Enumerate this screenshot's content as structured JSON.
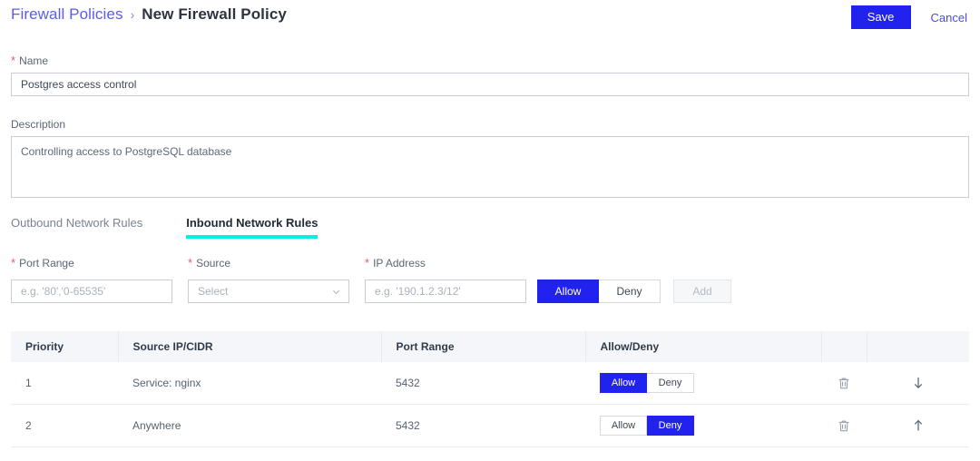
{
  "header": {
    "breadcrumb_root": "Firewall Policies",
    "breadcrumb_separator": "›",
    "breadcrumb_current": "New Firewall Policy",
    "save_label": "Save",
    "cancel_label": "Cancel",
    "accent_blue": "#2222ee",
    "link_blue": "#5b5bf0"
  },
  "form": {
    "name": {
      "label": "Name",
      "required": true,
      "value": "Postgres access control"
    },
    "description": {
      "label": "Description",
      "required": false,
      "value": "Controlling access to PostgreSQL database"
    }
  },
  "tabs": {
    "items": [
      {
        "label": "Outbound Network Rules",
        "active": false
      },
      {
        "label": "Inbound Network Rules",
        "active": true
      }
    ],
    "active_underline_color": "#06f0e0"
  },
  "rule_builder": {
    "port_range": {
      "label": "Port Range",
      "required": true,
      "placeholder": "e.g. '80','0-65535'",
      "value": ""
    },
    "source": {
      "label": "Source",
      "required": true,
      "selected": "Select"
    },
    "ip_address": {
      "label": "IP Address",
      "required": true,
      "placeholder": "e.g. '190.1.2.3/12'",
      "value": ""
    },
    "allow_label": "Allow",
    "deny_label": "Deny",
    "selected_action": "Allow",
    "add_label": "Add",
    "add_disabled": true
  },
  "table": {
    "columns": [
      "Priority",
      "Source IP/CIDR",
      "Port Range",
      "Allow/Deny",
      "",
      ""
    ],
    "rows": [
      {
        "priority": "1",
        "source": "Service: nginx",
        "port_range": "5432",
        "allow_label": "Allow",
        "deny_label": "Deny",
        "selected_action": "Allow",
        "delete_icon": "trash-icon",
        "move_icon": "arrow-down-icon"
      },
      {
        "priority": "2",
        "source": "Anywhere",
        "port_range": "5432",
        "allow_label": "Allow",
        "deny_label": "Deny",
        "selected_action": "Deny",
        "delete_icon": "trash-icon",
        "move_icon": "arrow-up-icon"
      }
    ]
  }
}
